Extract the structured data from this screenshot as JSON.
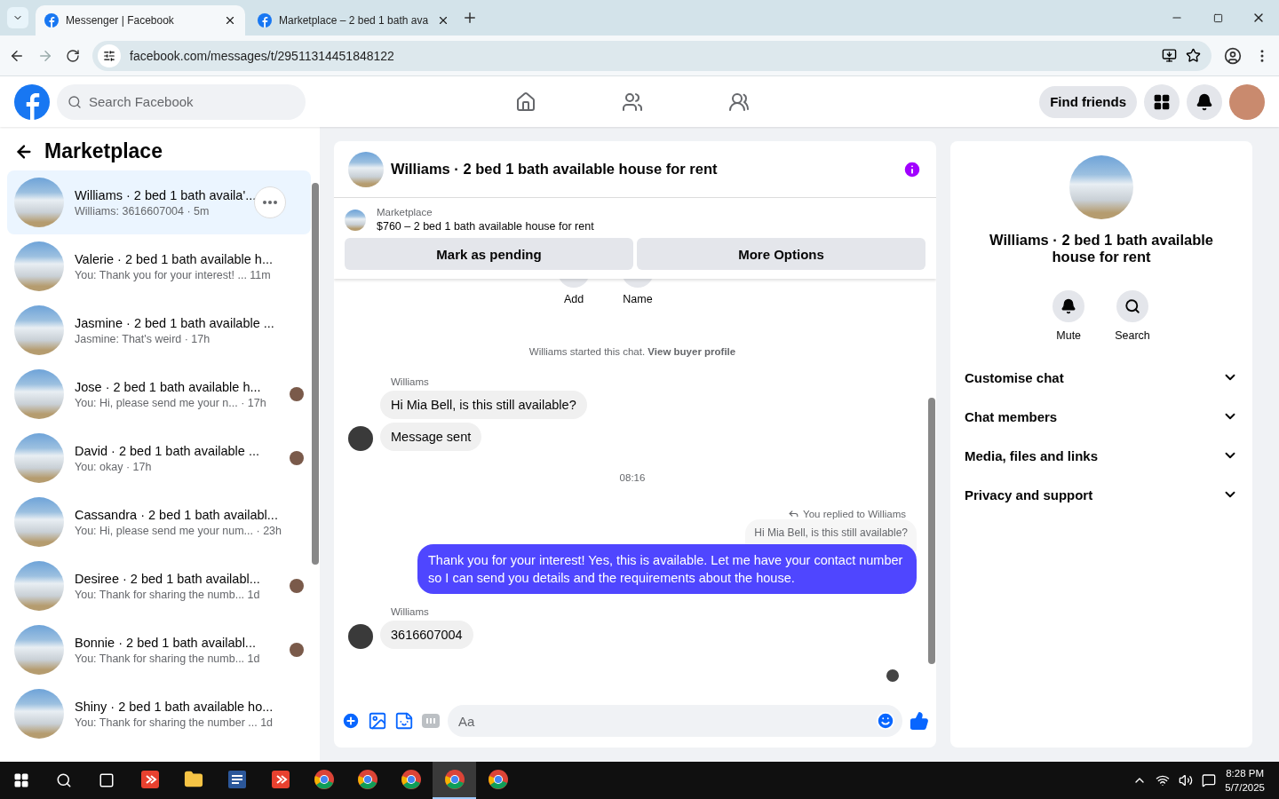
{
  "browser": {
    "tabs": [
      {
        "title": "Messenger | Facebook",
        "selected": true
      },
      {
        "title": "Marketplace – 2 bed 1 bath ava",
        "selected": false
      }
    ],
    "url": "facebook.com/messages/t/29511314451848122"
  },
  "header": {
    "search_placeholder": "Search Facebook",
    "nav": [
      {
        "kind": "home",
        "selected": false
      },
      {
        "kind": "friends",
        "selected": false
      },
      {
        "kind": "groups",
        "selected": false
      }
    ],
    "find_friends": "Find friends"
  },
  "sidebar": {
    "title": "Marketplace",
    "conversations": [
      {
        "title": "Williams · 2 bed 1 bath availa'...",
        "preview": "Williams: 3616607004 · 5m",
        "selected": true,
        "seen": false
      },
      {
        "title": "Valerie · 2 bed 1 bath available h...",
        "preview": "You: Thank you for your interest! ...  11m",
        "selected": false,
        "seen": false
      },
      {
        "title": "Jasmine · 2 bed 1 bath available ...",
        "preview": "Jasmine: That's weird · 17h",
        "selected": false,
        "seen": false
      },
      {
        "title": "Jose · 2 bed 1 bath available h...",
        "preview": "You: Hi, please send me your n...  · 17h",
        "selected": false,
        "seen": true
      },
      {
        "title": "David · 2 bed 1 bath available ...",
        "preview": "You: okay · 17h",
        "selected": false,
        "seen": true
      },
      {
        "title": "Cassandra · 2 bed 1 bath availabl...",
        "preview": "You: Hi, please send me your num... · 23h",
        "selected": false,
        "seen": false
      },
      {
        "title": "Desiree · 2 bed 1 bath availabl...",
        "preview": "You: Thank for sharing the numb...  1d",
        "selected": false,
        "seen": true
      },
      {
        "title": "Bonnie · 2 bed 1 bath availabl...",
        "preview": "You: Thank for sharing the numb...  1d",
        "selected": false,
        "seen": true
      },
      {
        "title": "Shiny · 2 bed 1 bath available ho...",
        "preview": "You: Thank for sharing the number ...  1d",
        "selected": false,
        "seen": false
      }
    ]
  },
  "chat": {
    "title": "Williams · 2 bed 1 bath available house for rent",
    "listing": {
      "source": "Marketplace",
      "label": "$760 – 2 bed 1 bath available house for rent",
      "buttons": [
        "Mark as pending",
        "More Options"
      ]
    },
    "quick_actions": [
      "Add",
      "Name"
    ],
    "messages": [
      {
        "kind": "system",
        "text": "Williams started this chat. **View buyer profile**"
      },
      {
        "kind": "sender",
        "text": "Williams"
      },
      {
        "kind": "incoming",
        "text": "Hi Mia Bell, is this still available?",
        "avatar": false
      },
      {
        "kind": "incoming",
        "text": "Message sent",
        "avatar": true
      },
      {
        "kind": "time",
        "text": "08:16"
      },
      {
        "kind": "reply_note",
        "text": "You replied to Williams"
      },
      {
        "kind": "quote",
        "text": "Hi Mia Bell, is this still available?"
      },
      {
        "kind": "outgoing",
        "text": "Thank you for your interest! Yes, this is available. Let me have your contact number so I can send you details and the requirements about the house."
      },
      {
        "kind": "sender",
        "text": "Williams"
      },
      {
        "kind": "incoming",
        "text": "3616607004",
        "avatar": true
      }
    ],
    "composer_placeholder": "Aa"
  },
  "details": {
    "title": "Williams · 2 bed 1 bath available house for rent",
    "actions": [
      "Mute",
      "Search"
    ],
    "sections": [
      {
        "label": "Customise chat",
        "expanded": false
      },
      {
        "label": "Chat members",
        "expanded": false
      },
      {
        "label": "Media, files and links",
        "expanded": false
      },
      {
        "label": "Privacy and support",
        "expanded": false
      }
    ]
  },
  "taskbar": {
    "apps": [
      {
        "kind": "app",
        "active": false
      },
      {
        "kind": "folder",
        "active": false
      },
      {
        "kind": "word",
        "active": false
      },
      {
        "kind": "app",
        "active": false
      },
      {
        "kind": "chrome",
        "active": false
      },
      {
        "kind": "chrome",
        "active": false
      },
      {
        "kind": "chrome",
        "active": false
      },
      {
        "kind": "chrome",
        "active": true
      },
      {
        "kind": "chrome",
        "active": false
      }
    ],
    "time": "8:28 PM",
    "date": "5/7/2025"
  }
}
